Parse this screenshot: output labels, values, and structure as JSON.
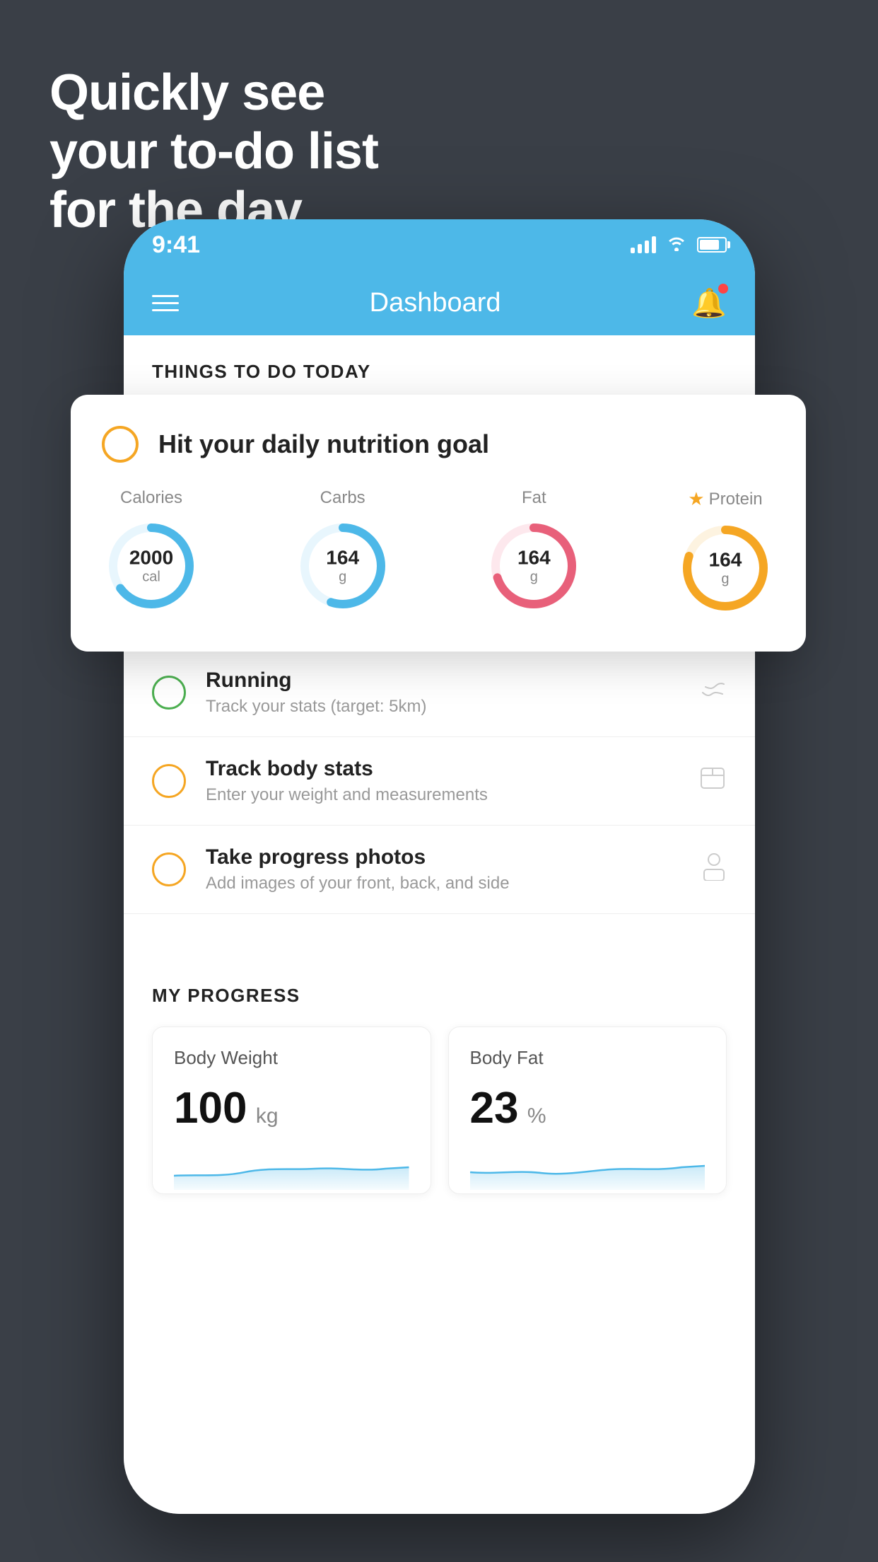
{
  "background": "#3a3f47",
  "hero": {
    "line1": "Quickly see",
    "line2": "your to-do list",
    "line3": "for the day."
  },
  "status_bar": {
    "time": "9:41",
    "bg_color": "#4db8e8"
  },
  "header": {
    "title": "Dashboard",
    "bg_color": "#4db8e8"
  },
  "things_today": {
    "section_label": "THINGS TO DO TODAY"
  },
  "floating_card": {
    "check_color": "#f5a623",
    "title": "Hit your daily nutrition goal",
    "nutrients": [
      {
        "label": "Calories",
        "value": "2000",
        "unit": "cal",
        "color": "#4db8e8",
        "percent": 65
      },
      {
        "label": "Carbs",
        "value": "164",
        "unit": "g",
        "color": "#4db8e8",
        "percent": 55
      },
      {
        "label": "Fat",
        "value": "164",
        "unit": "g",
        "color": "#e8607a",
        "percent": 70
      },
      {
        "label": "Protein",
        "value": "164",
        "unit": "g",
        "color": "#f5a623",
        "percent": 80,
        "starred": true
      }
    ]
  },
  "todo_items": [
    {
      "title": "Running",
      "subtitle": "Track your stats (target: 5km)",
      "circle_color": "green",
      "icon": "👟"
    },
    {
      "title": "Track body stats",
      "subtitle": "Enter your weight and measurements",
      "circle_color": "yellow",
      "icon": "⚖️"
    },
    {
      "title": "Take progress photos",
      "subtitle": "Add images of your front, back, and side",
      "circle_color": "yellow",
      "icon": "👤"
    }
  ],
  "my_progress": {
    "section_label": "MY PROGRESS",
    "cards": [
      {
        "title": "Body Weight",
        "value": "100",
        "unit": "kg"
      },
      {
        "title": "Body Fat",
        "value": "23",
        "unit": "%"
      }
    ]
  }
}
